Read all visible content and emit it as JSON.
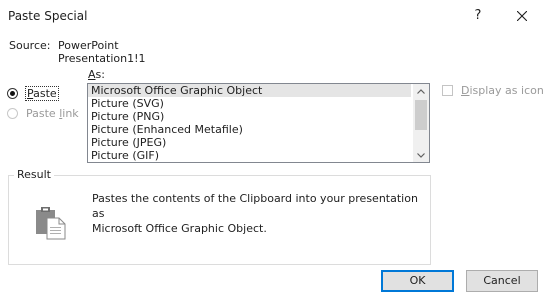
{
  "window": {
    "title": "Paste Special",
    "help_glyph": "?"
  },
  "source": {
    "label": "Source:",
    "app": "PowerPoint",
    "document": "Presentation1!1"
  },
  "paste_options": {
    "as_label_char": "A",
    "as_label_rest": "s:",
    "paste": {
      "underline": "P",
      "rest": "aste",
      "selected": true
    },
    "paste_link": {
      "before": "Paste ",
      "underline": "l",
      "rest": "ink",
      "disabled": true
    }
  },
  "formats": {
    "items": [
      "Microsoft Office Graphic Object",
      "Picture (SVG)",
      "Picture (PNG)",
      "Picture (Enhanced Metafile)",
      "Picture (JPEG)",
      "Picture (GIF)"
    ],
    "selected_index": 0
  },
  "display_as_icon": {
    "underline": "D",
    "rest": "isplay as icon",
    "checked": false,
    "disabled": true
  },
  "result": {
    "legend": "Result",
    "line1": "Pastes the contents of the Clipboard into your presentation as",
    "line2": "Microsoft Office Graphic Object.",
    "icon": "clipboard-paste-icon"
  },
  "buttons": {
    "ok": "OK",
    "cancel": "Cancel"
  },
  "colors": {
    "accent": "#0078d7",
    "selected_row": "#e5e5e5",
    "disabled_text": "#9a9a9a"
  }
}
